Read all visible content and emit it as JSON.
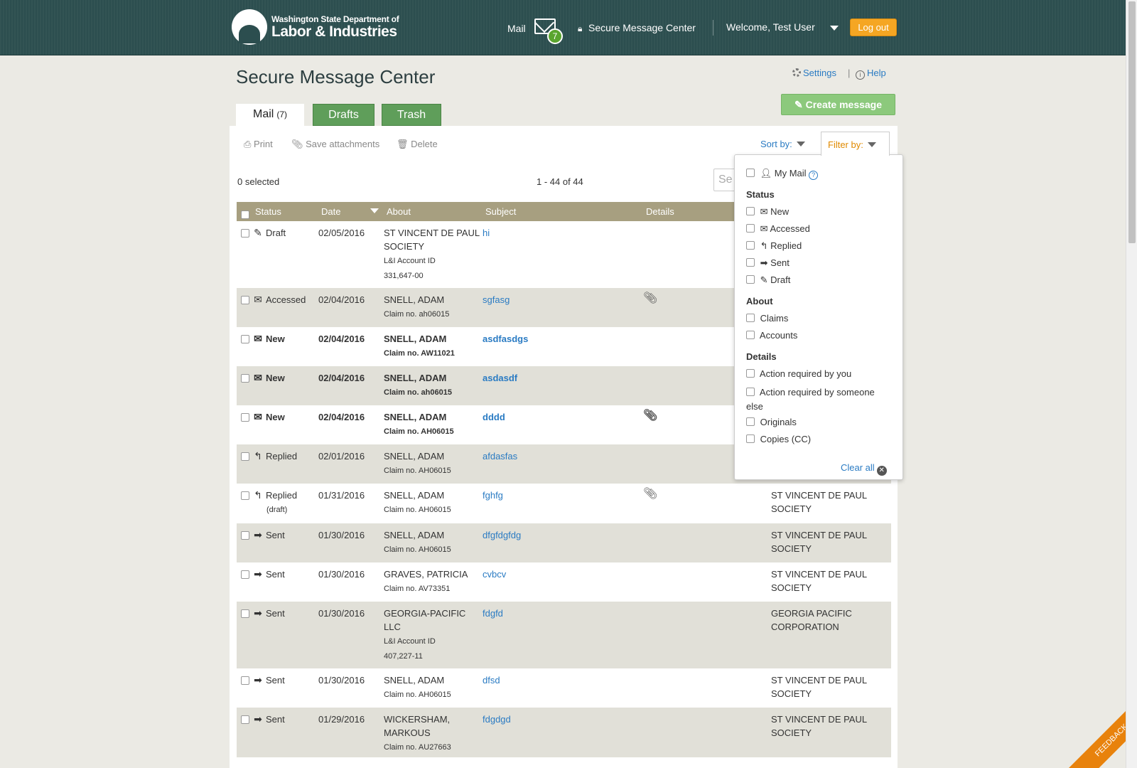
{
  "header": {
    "logo_line1": "Washington State Department of",
    "logo_line2": "Labor & Industries",
    "mail_label": "Mail",
    "mail_count": "7",
    "secure_label": "Secure Message Center",
    "welcome": "Welcome, Test User",
    "logout": "Log out"
  },
  "page": {
    "title": "Secure Message Center",
    "settings": "Settings",
    "help": "Help",
    "create": "Create message"
  },
  "tabs": {
    "mail": "Mail",
    "mail_count": "(7)",
    "drafts": "Drafts",
    "trash": "Trash"
  },
  "toolbar": {
    "print": "Print",
    "save_attachments": "Save attachments",
    "delete": "Delete",
    "sort_by": "Sort by:",
    "filter_by": "Filter by:",
    "selected": "0 selected",
    "pagination": "1 - 44 of 44",
    "search_placeholder": "Se"
  },
  "table": {
    "headers": [
      "Status",
      "Date",
      "About",
      "Subject",
      "Details"
    ],
    "rows": [
      {
        "status": "Draft",
        "icon": "pencil-icon",
        "date": "02/05/2016",
        "about": "ST VINCENT DE PAUL SOCIETY",
        "about_sub1": "L&I Account ID",
        "about_sub2": "331,647-00",
        "subject": "hi",
        "attach": false,
        "from": "",
        "bold": false
      },
      {
        "status": "Accessed",
        "icon": "envelope-open-icon",
        "date": "02/04/2016",
        "about": "SNELL, ADAM",
        "about_sub1": "Claim no. ah06015",
        "subject": "sgfasg",
        "attach": true,
        "from": "",
        "bold": false
      },
      {
        "status": "New",
        "icon": "envelope-icon",
        "date": "02/04/2016",
        "about": "SNELL, ADAM",
        "about_sub1": "Claim no. AW11021",
        "subject": "asdfasdgs",
        "attach": false,
        "from": "",
        "bold": true
      },
      {
        "status": "New",
        "icon": "envelope-icon",
        "date": "02/04/2016",
        "about": "SNELL, ADAM",
        "about_sub1": "Claim no. ah06015",
        "subject": "asdasdf",
        "attach": false,
        "from": "",
        "bold": true
      },
      {
        "status": "New",
        "icon": "envelope-icon",
        "date": "02/04/2016",
        "about": "SNELL, ADAM",
        "about_sub1": "Claim no. AH06015",
        "subject": "dddd",
        "attach": true,
        "from": "",
        "bold": true
      },
      {
        "status": "Replied",
        "icon": "reply-icon",
        "date": "02/01/2016",
        "about": "SNELL, ADAM",
        "about_sub1": "Claim no. AH06015",
        "subject": "afdasfas",
        "attach": false,
        "from": "",
        "bold": false
      },
      {
        "status": "Replied",
        "status_sub": "(draft)",
        "icon": "reply-icon",
        "date": "01/31/2016",
        "about": "SNELL, ADAM",
        "about_sub1": "Claim no. AH06015",
        "subject": "fghfg",
        "attach": true,
        "from": "ST VINCENT DE PAUL SOCIETY",
        "bold": false
      },
      {
        "status": "Sent",
        "icon": "arrow-right-icon",
        "date": "01/30/2016",
        "about": "SNELL, ADAM",
        "about_sub1": "Claim no. AH06015",
        "subject": "dfgfdgfdg",
        "attach": false,
        "from": "ST VINCENT DE PAUL SOCIETY",
        "bold": false
      },
      {
        "status": "Sent",
        "icon": "arrow-right-icon",
        "date": "01/30/2016",
        "about": "GRAVES, PATRICIA",
        "about_sub1": "Claim no. AV73351",
        "subject": "cvbcv",
        "attach": false,
        "from": "ST VINCENT DE PAUL SOCIETY",
        "bold": false
      },
      {
        "status": "Sent",
        "icon": "arrow-right-icon",
        "date": "01/30/2016",
        "about": "GEORGIA-PACIFIC LLC",
        "about_sub1": "L&I Account ID",
        "about_sub2": "407,227-11",
        "subject": "fdgfd",
        "attach": false,
        "from": "GEORGIA PACIFIC CORPORATION",
        "bold": false
      },
      {
        "status": "Sent",
        "icon": "arrow-right-icon",
        "date": "01/30/2016",
        "about": "SNELL, ADAM",
        "about_sub1": "Claim no. AH06015",
        "subject": "dfsd",
        "attach": false,
        "from": "ST VINCENT DE PAUL SOCIETY",
        "bold": false
      },
      {
        "status": "Sent",
        "icon": "arrow-right-icon",
        "date": "01/29/2016",
        "about": "WICKERSHAM, MARKOUS",
        "about_sub1": "Claim no. AU27663",
        "subject": "fdgdgd",
        "attach": false,
        "from": "ST VINCENT DE PAUL SOCIETY",
        "bold": false
      }
    ]
  },
  "filter": {
    "my_mail": "My Mail",
    "status_heading": "Status",
    "status_new": "New",
    "status_accessed": "Accessed",
    "status_replied": "Replied",
    "status_sent": "Sent",
    "status_draft": "Draft",
    "about_heading": "About",
    "about_claims": "Claims",
    "about_accounts": "Accounts",
    "details_heading": "Details",
    "details_action_you": "Action required by you",
    "details_action_else_1": "Action required by someone",
    "details_action_else_2": "else",
    "details_originals": "Originals",
    "details_copies": "Copies (CC)",
    "clear_all": "Clear all"
  },
  "feedback": "FEEDBACK",
  "colors": {
    "header_bg": "#2c4e4f",
    "tab_green": "#5f9e5a",
    "create_green": "#8cc97c",
    "logout_orange": "#f5a623",
    "table_header": "#a79f80",
    "row_alt": "#e1e0d8",
    "link_blue": "#2a7bc3"
  }
}
